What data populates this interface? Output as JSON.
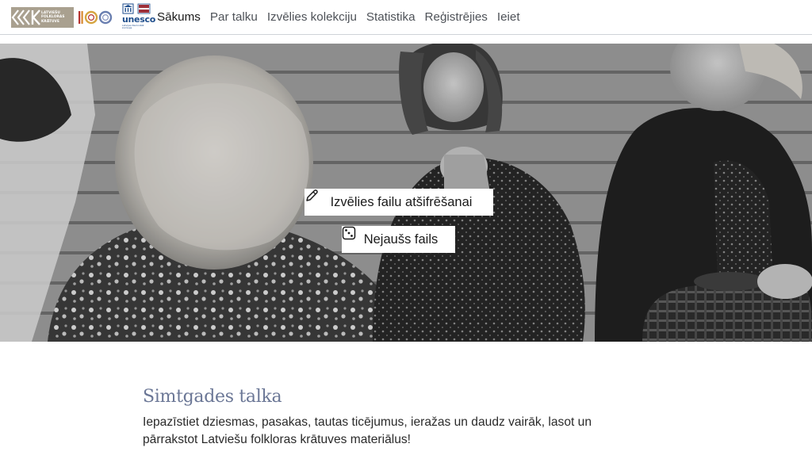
{
  "brand": {
    "lfk_logo_lines": [
      "LATVIEŠU",
      "FOLKLORAS",
      "KRĀTUVE"
    ],
    "lfk_logo_mark": "LFK",
    "centenary_mark": "100",
    "unesco_word": "unesco",
    "unesco_subtext": "Latvijas Nacionālā komisija"
  },
  "nav": {
    "items": [
      {
        "label": "Sākums",
        "active": true
      },
      {
        "label": "Par talku",
        "active": false
      },
      {
        "label": "Izvēlies kolekciju",
        "active": false
      },
      {
        "label": "Statistika",
        "active": false
      },
      {
        "label": "Reģistrējies",
        "active": false
      },
      {
        "label": "Ieiet",
        "active": false
      }
    ]
  },
  "hero": {
    "transcribe_label": "Izvēlies failu atšifrēšanai",
    "transcribe_icon": "pencil-icon",
    "random_label": "Nejaušs fails",
    "random_icon": "dice-icon"
  },
  "intro": {
    "title": "Simtgades talka",
    "text": "Iepazīstiet dziesmas, pasakas, tautas ticējumus, ieražas un daudz vairāk, lasot un pārrakstot Latviešu folkloras krātuves materiālus!"
  },
  "colors": {
    "lfk_logo_bg": "#a9a08f",
    "unesco_blue": "#1f4e8c",
    "title_color": "#6b7796",
    "nav_text": "#4e5258"
  }
}
